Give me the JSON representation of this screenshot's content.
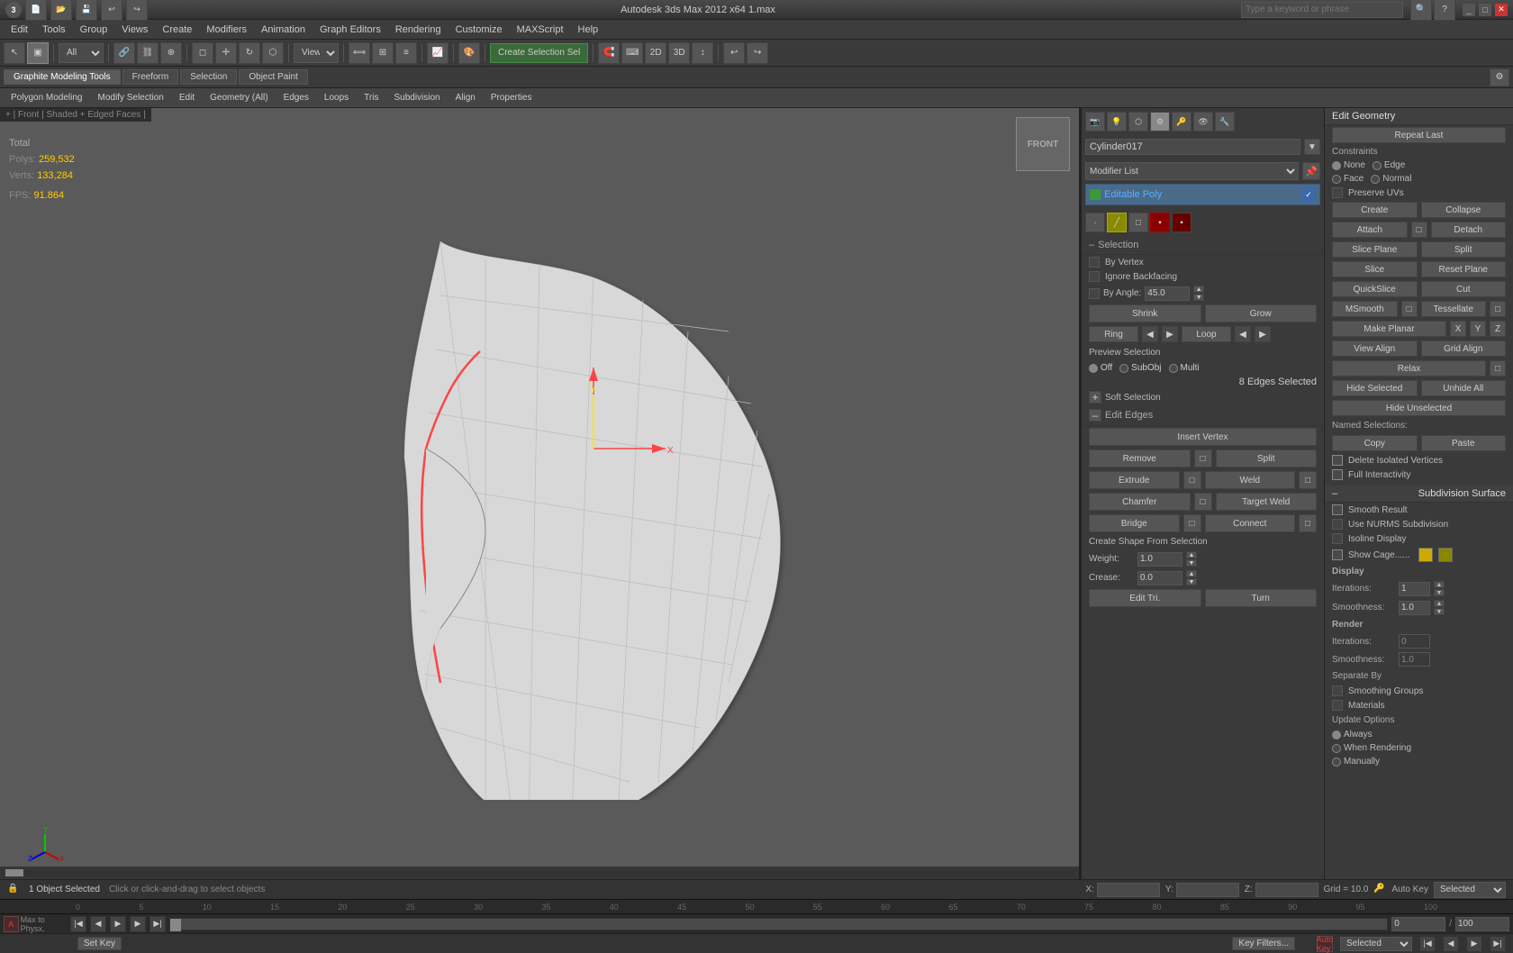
{
  "titlebar": {
    "title": "Autodesk 3ds Max 2012 x64  1.max",
    "search_placeholder": "Type a keyword or phrase"
  },
  "menubar": {
    "items": [
      "Edit",
      "Tools",
      "Group",
      "Views",
      "Create",
      "Modifiers",
      "Animation",
      "Graph Editors",
      "Rendering",
      "Customize",
      "MAXScript",
      "Help"
    ]
  },
  "toolbar": {
    "create_selection": "Create Selection Sel",
    "dropdown_view": "View"
  },
  "ribbon": {
    "tabs": [
      {
        "label": "Graphite Modeling Tools",
        "active": true
      },
      {
        "label": "Freeform",
        "active": false
      },
      {
        "label": "Selection",
        "active": false
      },
      {
        "label": "Object Paint",
        "active": false
      }
    ]
  },
  "subribbon": {
    "tabs": [
      "Polygon Modeling",
      "Modify Selection",
      "Edit",
      "Geometry (All)",
      "Edges",
      "Loops",
      "Tris",
      "Subdivision",
      "Align",
      "Properties"
    ]
  },
  "viewport": {
    "label": "+ | Front | Shaded + Edged Faces |",
    "stats": {
      "total_label": "Total",
      "polys_label": "Polys:",
      "polys_value": "259,532",
      "verts_label": "Verts:",
      "verts_value": "133,284",
      "fps_label": "FPS:",
      "fps_value": "91.864"
    }
  },
  "right_panel": {
    "object_name": "Cylinder017",
    "modifier_list_label": "Modifier List",
    "modifier": "Editable Poly",
    "icons": {
      "icon1": "⬡",
      "icon2": "▦",
      "icon3": "✂",
      "icon4": "↕",
      "icon5": "⊕"
    },
    "selection": {
      "title": "Selection",
      "by_vertex": "By Vertex",
      "ignore_backfacing": "Ignore Backfacing",
      "by_angle": "By Angle:",
      "angle_value": "45.0",
      "shrink": "Shrink",
      "grow": "Grow",
      "ring": "Ring",
      "loop": "Loop",
      "preview_label": "Preview Selection",
      "off": "Off",
      "subobj": "SubObj",
      "multi": "Multi",
      "edge_count": "8 Edges Selected"
    },
    "soft_selection": {
      "title": "Soft Selection"
    },
    "edit_edges": {
      "title": "Edit Edges",
      "insert_vertex": "Insert Vertex",
      "remove": "Remove",
      "split": "Split",
      "extrude": "Extrude",
      "weld": "Weld",
      "chamfer": "Chamfer",
      "target_weld": "Target Weld",
      "bridge": "Bridge",
      "connect": "Connect",
      "create_shape": "Create Shape From Selection",
      "weight_label": "Weight:",
      "weight_value": "1.0",
      "crease_label": "Crease:",
      "crease_value": "0.0",
      "edit_tri": "Edit Tri.",
      "turn": "Turn"
    }
  },
  "edit_geometry_panel": {
    "title": "Edit Geometry",
    "repeat_last": "Repeat Last",
    "constraints_label": "Constraints",
    "none": "None",
    "edge": "Edge",
    "face": "Face",
    "normal": "Normal",
    "preserve_uvs": "Preserve UVs",
    "create": "Create",
    "collapse": "Collapse",
    "attach": "Attach",
    "detach": "Detach",
    "slice_plane": "Slice Plane",
    "split": "Split",
    "slice": "Slice",
    "reset_plane": "Reset Plane",
    "quickslice": "QuickSlice",
    "cut": "Cut",
    "msmooth": "MSmooth",
    "tessellate": "Tessellate",
    "make_planar": "Make Planar",
    "x": "X",
    "y": "Y",
    "z": "Z",
    "view_align": "View Align",
    "grid_align": "Grid Align",
    "relax": "Relax",
    "hide_selected": "Hide Selected",
    "unhide_all": "Unhide All",
    "hide_unselected": "Hide Unselected",
    "named_selections": "Named Selections:",
    "copy": "Copy",
    "paste": "Paste",
    "delete_isolated": "Delete Isolated Vertices",
    "full_interactivity": "Full Interactivity",
    "subdivision_surface": "Subdivision Surface",
    "smooth_result": "Smooth Result",
    "use_nurms": "Use NURMS Subdivision",
    "isoline_display": "Isoline Display",
    "show_cage": "Show Cage......",
    "display_label": "Display",
    "iterations_label": "Iterations:",
    "iterations_val": "1",
    "smoothness_label": "Smoothness:",
    "smoothness_val": "1.0",
    "render_label": "Render",
    "render_iter_val": "0",
    "render_smooth_val": "1.0",
    "separate_by": "Separate By",
    "smoothing_groups": "Smoothing Groups",
    "materials": "Materials",
    "update_options": "Update Options",
    "always": "Always",
    "when_rendering": "When Rendering",
    "manually": "Manually"
  },
  "statusbar": {
    "object_count": "1 Object Selected",
    "instruction": "Click or click-and-drag to select objects",
    "x_label": "X:",
    "y_label": "Y:",
    "z_label": "Z:",
    "grid_label": "Grid = 10.0",
    "key_label": "Auto Key",
    "selected": "Selected"
  },
  "timeline": {
    "frame_current": "0",
    "frame_total": "100",
    "numbers": [
      "0",
      "5",
      "10",
      "15",
      "20",
      "25",
      "30",
      "35",
      "40",
      "45",
      "50",
      "55",
      "60",
      "65",
      "70",
      "75",
      "80",
      "85",
      "90",
      "95",
      "100"
    ]
  },
  "keybar": {
    "set_key": "Set Key",
    "key_filters": "Key Filters...",
    "auto_key": "Auto Key",
    "selected_label": "Selected"
  }
}
